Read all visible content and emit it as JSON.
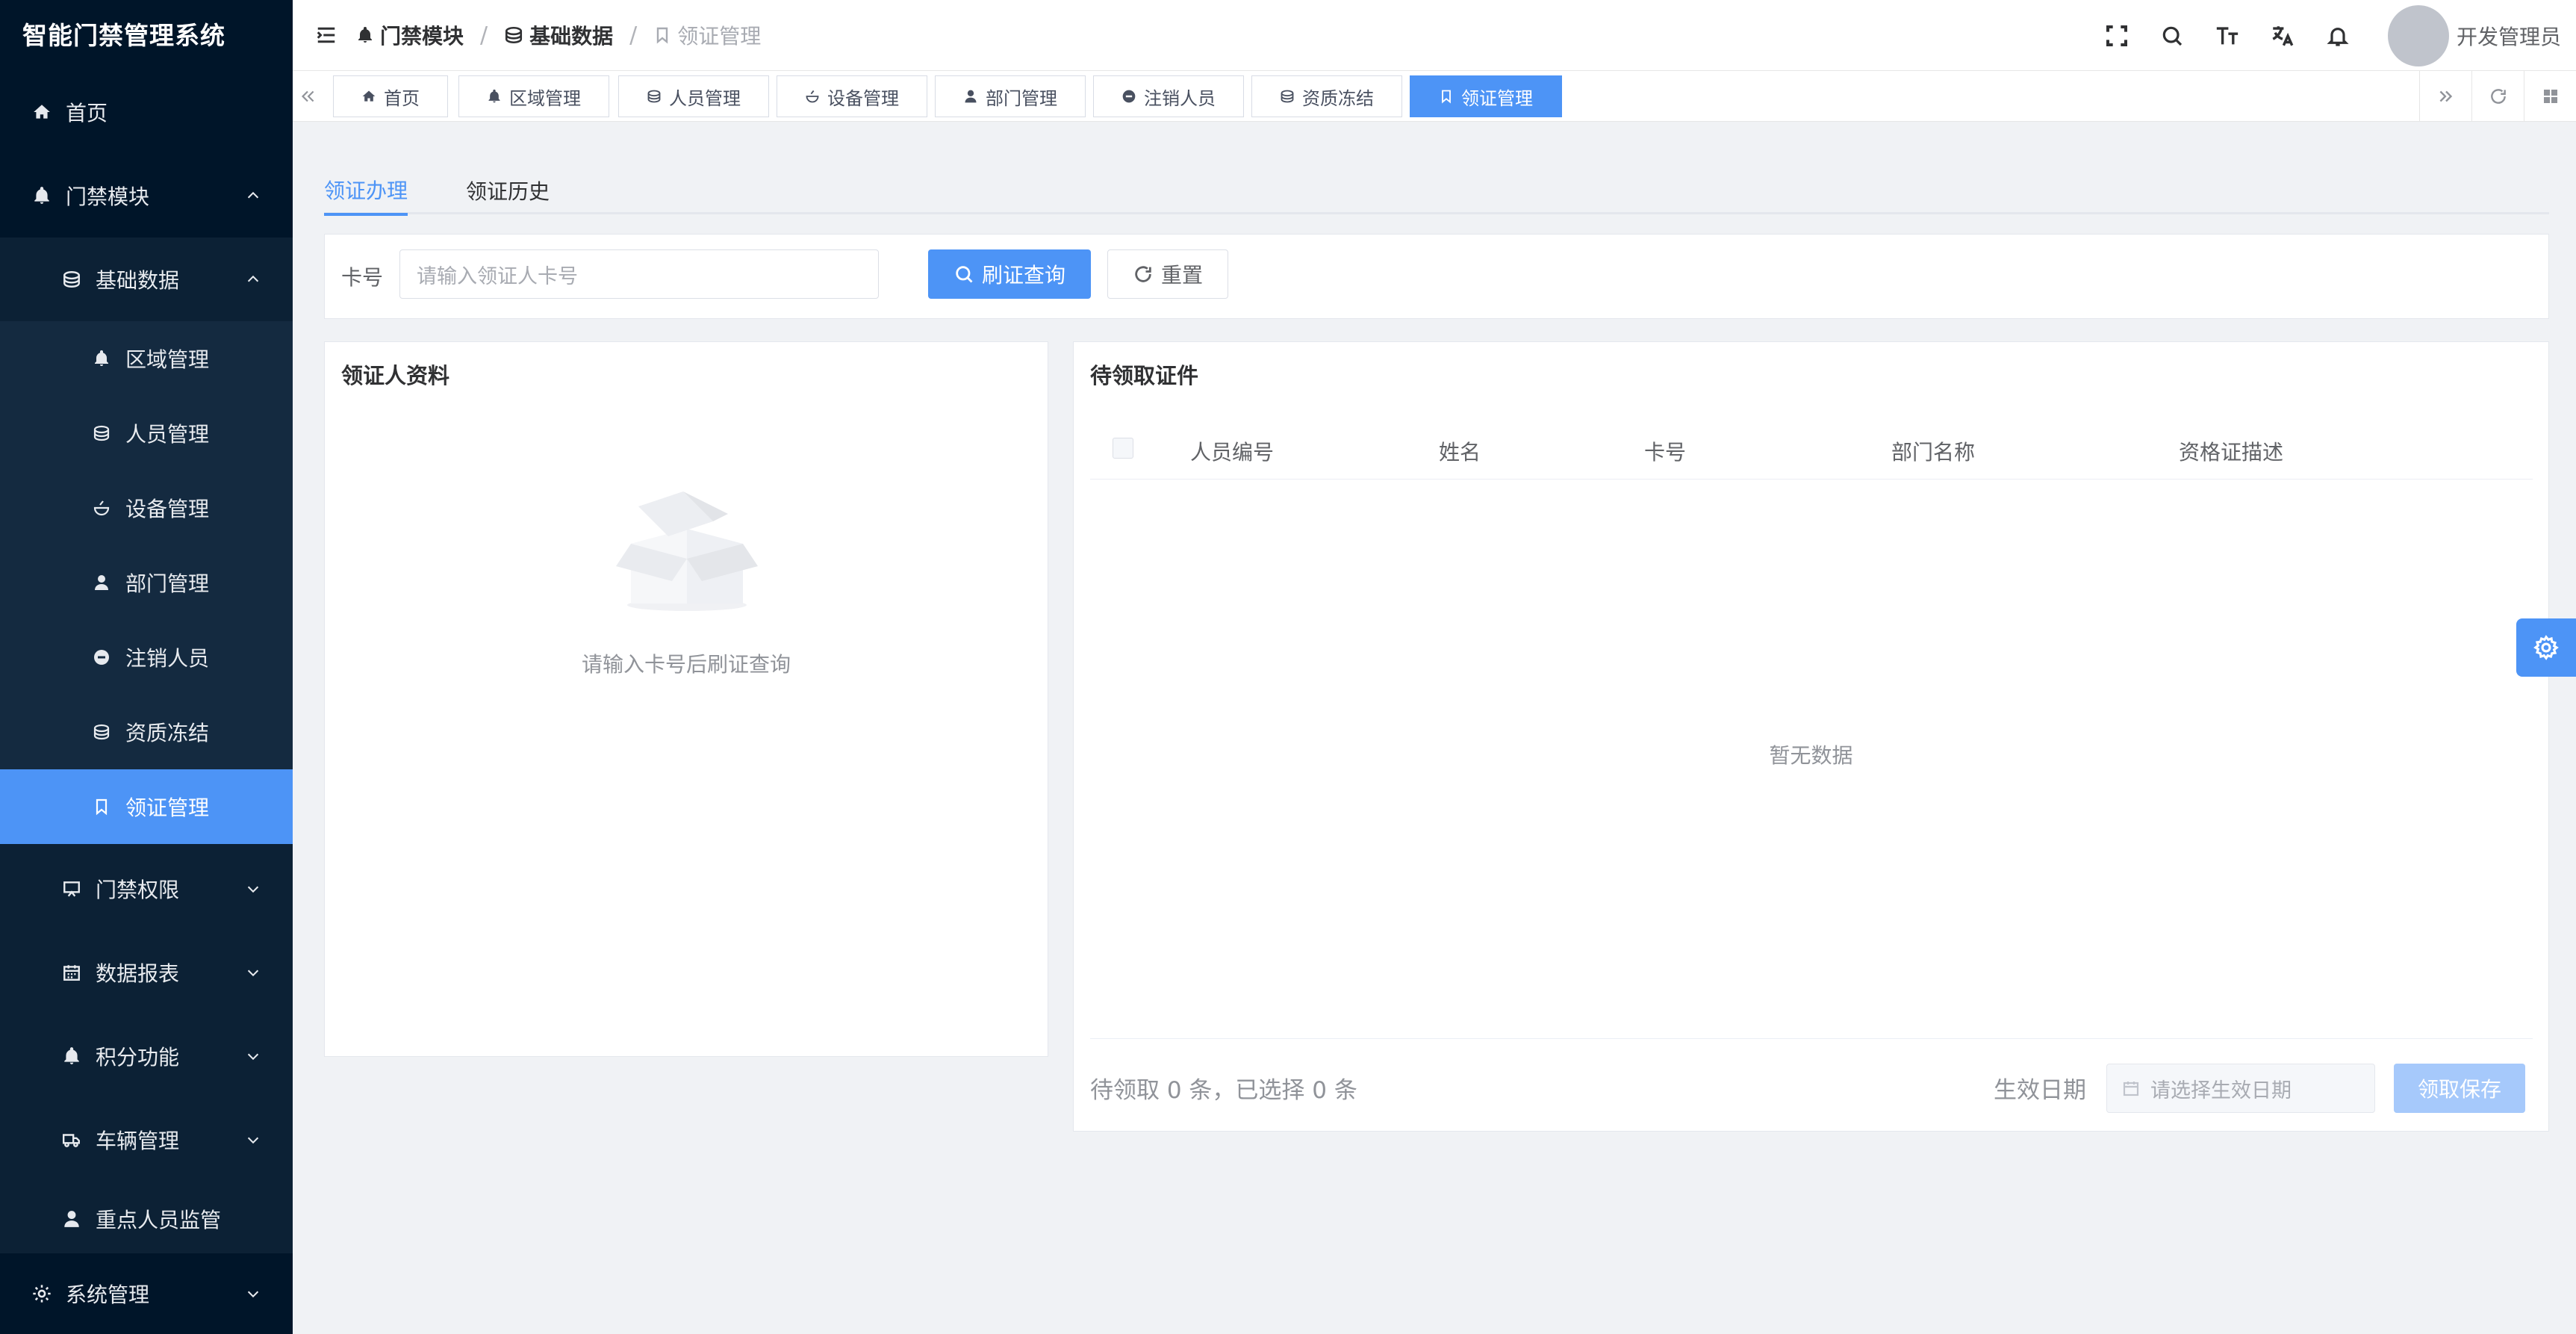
{
  "app": {
    "title": "智能门禁管理系统"
  },
  "sidebar": {
    "home": "首页",
    "access_module": "门禁模块",
    "basic_data": "基础数据",
    "sub": [
      "区域管理",
      "人员管理",
      "设备管理",
      "部门管理",
      "注销人员",
      "资质冻结",
      "领证管理"
    ],
    "after": [
      "门禁权限",
      "数据报表",
      "积分功能",
      "车辆管理",
      "重点人员监管"
    ],
    "system": "系统管理",
    "active_color": "#4d94f6"
  },
  "breadcrumb": [
    "门禁模块",
    "基础数据",
    "领证管理"
  ],
  "header": {
    "user_name": "开发管理员"
  },
  "tags": [
    "首页",
    "区域管理",
    "人员管理",
    "设备管理",
    "部门管理",
    "注销人员",
    "资质冻结",
    "领证管理"
  ],
  "tabs": [
    "领证办理",
    "领证历史"
  ],
  "search": {
    "label": "卡号",
    "placeholder": "请输入领证人卡号",
    "query_btn": "刷证查询",
    "reset_btn": "重置"
  },
  "left_panel": {
    "title": "领证人资料",
    "empty_hint": "请输入卡号后刷证查询"
  },
  "right_panel": {
    "title": "待领取证件",
    "columns": [
      "人员编号",
      "姓名",
      "卡号",
      "部门名称",
      "资格证描述"
    ],
    "no_data": "暂无数据",
    "count_text": "待领取 0 条，已选择 0 条",
    "date_label": "生效日期",
    "date_placeholder": "请选择生效日期",
    "save_btn": "领取保存"
  }
}
